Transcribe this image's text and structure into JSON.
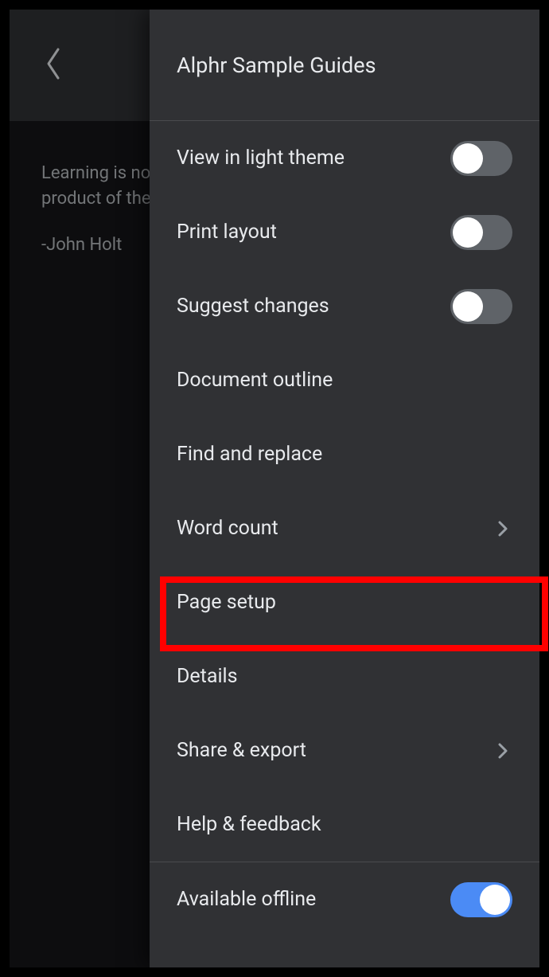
{
  "document": {
    "body_line1": "Learning is not the",
    "body_line2": "product of the activity",
    "attribution": "-John Holt"
  },
  "panel": {
    "title": "Alphr Sample Guides"
  },
  "menu": {
    "view_light_theme": {
      "label": "View in light theme",
      "toggle": "off"
    },
    "print_layout": {
      "label": "Print layout",
      "toggle": "off"
    },
    "suggest_changes": {
      "label": "Suggest changes",
      "toggle": "off"
    },
    "document_outline": {
      "label": "Document outline"
    },
    "find_replace": {
      "label": "Find and replace"
    },
    "word_count": {
      "label": "Word count",
      "chevron": true
    },
    "page_setup": {
      "label": "Page setup"
    },
    "details": {
      "label": "Details"
    },
    "share_export": {
      "label": "Share & export",
      "chevron": true
    },
    "help_feedback": {
      "label": "Help & feedback"
    },
    "available_offline": {
      "label": "Available offline",
      "toggle": "on-blue"
    }
  }
}
